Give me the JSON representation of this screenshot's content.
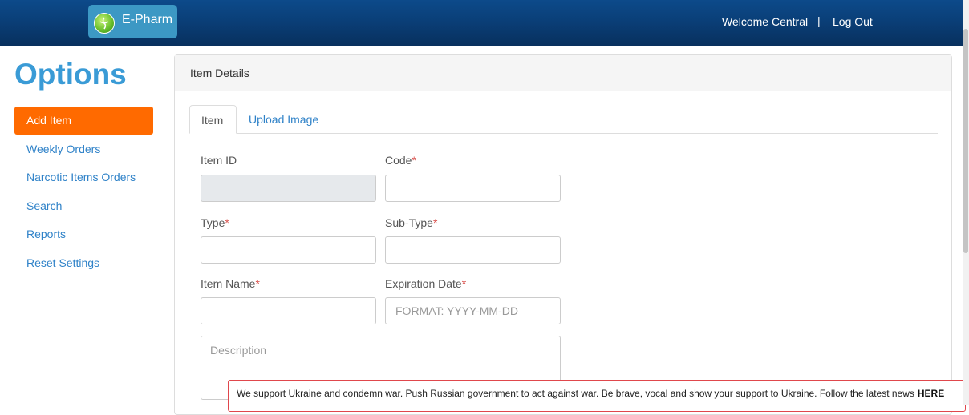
{
  "navbar": {
    "brand": "E-Pharm",
    "welcome": "Welcome Central",
    "separator": "|",
    "logout": "Log Out"
  },
  "sidebar": {
    "title": "Options",
    "items": [
      {
        "label": "Add Item",
        "active": true
      },
      {
        "label": "Weekly Orders"
      },
      {
        "label": "Narcotic Items Orders"
      },
      {
        "label": "Search"
      },
      {
        "label": "Reports"
      },
      {
        "label": "Reset Settings"
      }
    ]
  },
  "panel": {
    "heading": "Item Details",
    "tabs": [
      {
        "label": "Item",
        "active": true
      },
      {
        "label": "Upload Image"
      }
    ]
  },
  "form": {
    "item_id": {
      "label": "Item ID",
      "value": ""
    },
    "code": {
      "label": "Code",
      "required": "*",
      "value": ""
    },
    "type": {
      "label": "Type",
      "required": "*",
      "value": ""
    },
    "sub_type": {
      "label": "Sub-Type",
      "required": "*",
      "value": ""
    },
    "item_name": {
      "label": "Item Name",
      "required": "*",
      "value": ""
    },
    "expiration_date": {
      "label": "Expiration Date",
      "required": "*",
      "placeholder": "FORMAT: YYYY-MM-DD",
      "value": ""
    },
    "description": {
      "placeholder": "Description"
    }
  },
  "banner": {
    "text": "We support Ukraine and condemn war. Push Russian government to act against war. Be brave, vocal and show your support to Ukraine. Follow the latest news",
    "link": "HERE"
  },
  "colors": {
    "navbar": "#0a3f78",
    "accent_active": "#ff6a00",
    "link": "#2f82c8",
    "title": "#3a9bd6",
    "required": "#d9534f"
  }
}
